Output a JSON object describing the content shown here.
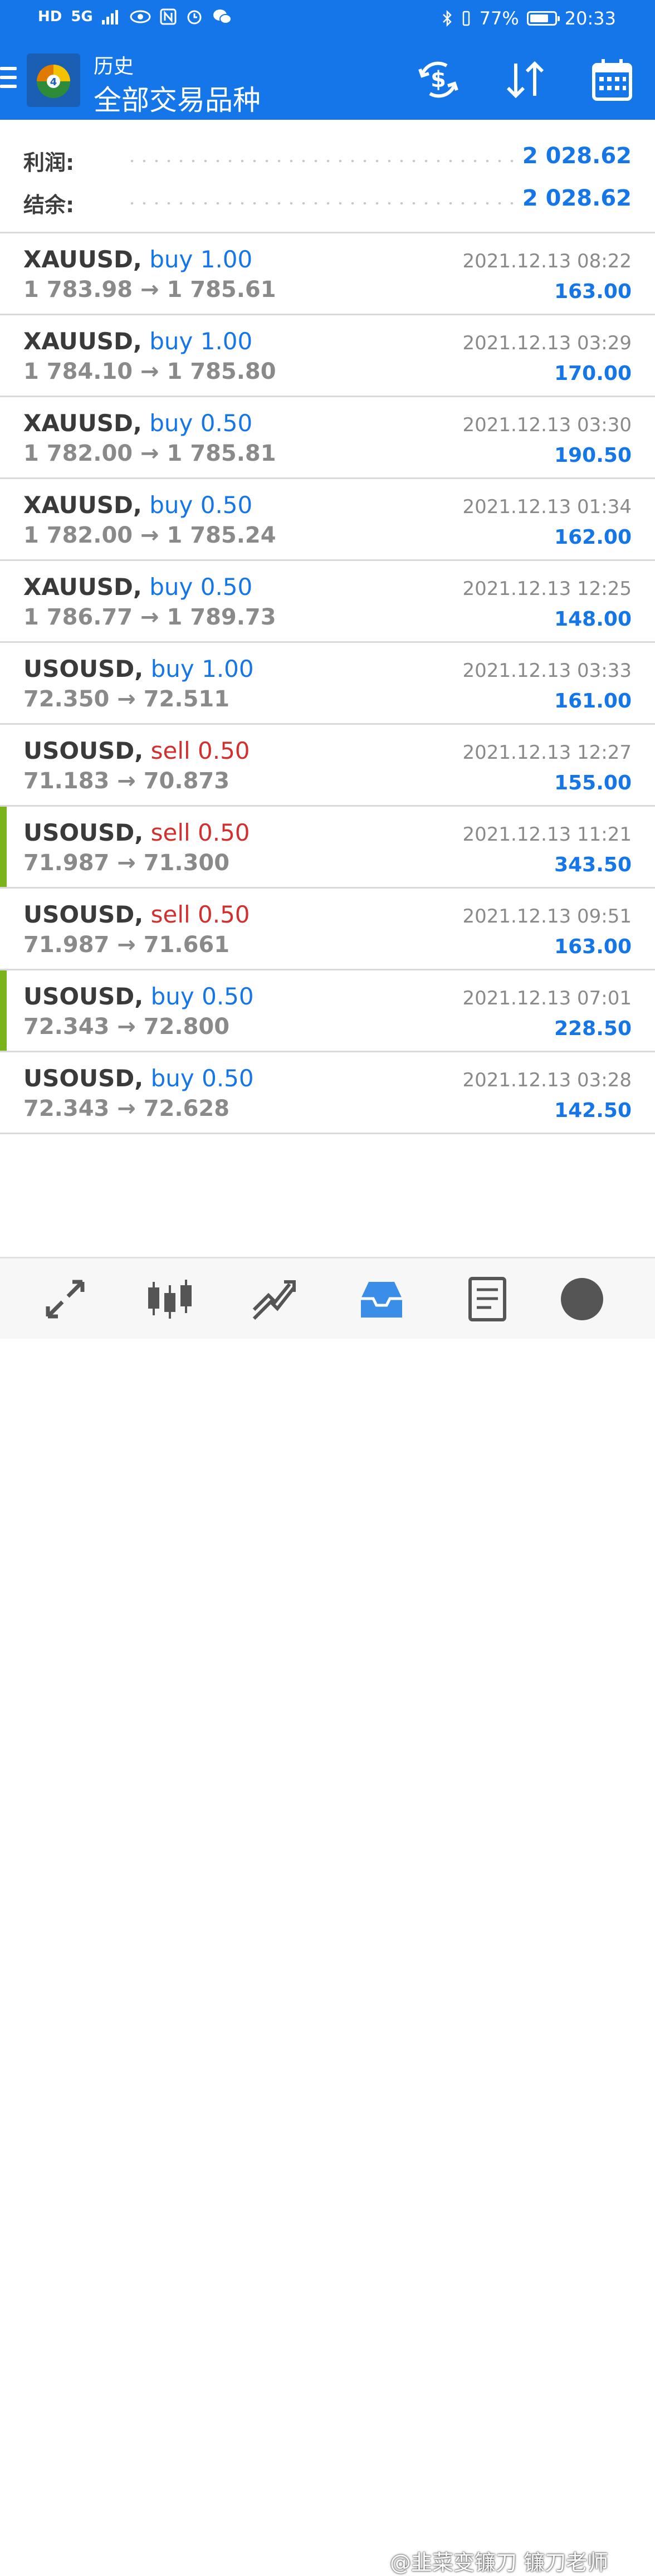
{
  "status_bar": {
    "left_indicators": [
      "HD",
      "5G"
    ],
    "battery_level": 0.77,
    "battery_text": "77%",
    "time": "20:33"
  },
  "toolbar": {
    "subtitle": "历史",
    "title": "全部交易品种",
    "icons": [
      "menu-icon",
      "metatrader-logo",
      "dollar-exchange-icon",
      "sort-icon",
      "calendar-icon"
    ]
  },
  "summary": {
    "profit_label": "利润:",
    "profit_value": "2 028.62",
    "balance_label": "结余:",
    "balance_value": "2 028.62"
  },
  "trades": [
    {
      "symbol": "XAUUSD,",
      "side": "buy",
      "volume": "1.00",
      "prices": "1 783.98 → 1 785.61",
      "time": "2021.12.13 08:22",
      "profit": "163.00",
      "marked": false
    },
    {
      "symbol": "XAUUSD,",
      "side": "buy",
      "volume": "1.00",
      "prices": "1 784.10 → 1 785.80",
      "time": "2021.12.13 03:29",
      "profit": "170.00",
      "marked": false
    },
    {
      "symbol": "XAUUSD,",
      "side": "buy",
      "volume": "0.50",
      "prices": "1 782.00 → 1 785.81",
      "time": "2021.12.13 03:30",
      "profit": "190.50",
      "marked": false
    },
    {
      "symbol": "XAUUSD,",
      "side": "buy",
      "volume": "0.50",
      "prices": "1 782.00 → 1 785.24",
      "time": "2021.12.13 01:34",
      "profit": "162.00",
      "marked": false
    },
    {
      "symbol": "XAUUSD,",
      "side": "buy",
      "volume": "0.50",
      "prices": "1 786.77 → 1 789.73",
      "time": "2021.12.13 12:25",
      "profit": "148.00",
      "marked": false
    },
    {
      "symbol": "USOUSD,",
      "side": "buy",
      "volume": "1.00",
      "prices": "72.350 → 72.511",
      "time": "2021.12.13 03:33",
      "profit": "161.00",
      "marked": false
    },
    {
      "symbol": "USOUSD,",
      "side": "sell",
      "volume": "0.50",
      "prices": "71.183 → 70.873",
      "time": "2021.12.13 12:27",
      "profit": "155.00",
      "marked": false
    },
    {
      "symbol": "USOUSD,",
      "side": "sell",
      "volume": "0.50",
      "prices": "71.987 → 71.300",
      "time": "2021.12.13 11:21",
      "profit": "343.50",
      "marked": true
    },
    {
      "symbol": "USOUSD,",
      "side": "sell",
      "volume": "0.50",
      "prices": "71.987 → 71.661",
      "time": "2021.12.13 09:51",
      "profit": "163.00",
      "marked": false
    },
    {
      "symbol": "USOUSD,",
      "side": "buy",
      "volume": "0.50",
      "prices": "72.343 → 72.800",
      "time": "2021.12.13 07:01",
      "profit": "228.50",
      "marked": true
    },
    {
      "symbol": "USOUSD,",
      "side": "buy",
      "volume": "0.50",
      "prices": "72.343 → 72.628",
      "time": "2021.12.13 03:28",
      "profit": "142.50",
      "marked": false
    }
  ],
  "bottom_nav": {
    "items": [
      "quotes-arrows-icon",
      "chart-candles-icon",
      "trade-chart-icon",
      "history-inbox-icon",
      "news-icon",
      "chat-icon"
    ]
  },
  "watermark": "@韭菜变镰刀 镰刀老师",
  "colors": {
    "header": "#1476e8",
    "buy": "#1476e8",
    "sell": "#d32f2f",
    "profit": "#1476e8",
    "marker": "#7bb31a"
  }
}
